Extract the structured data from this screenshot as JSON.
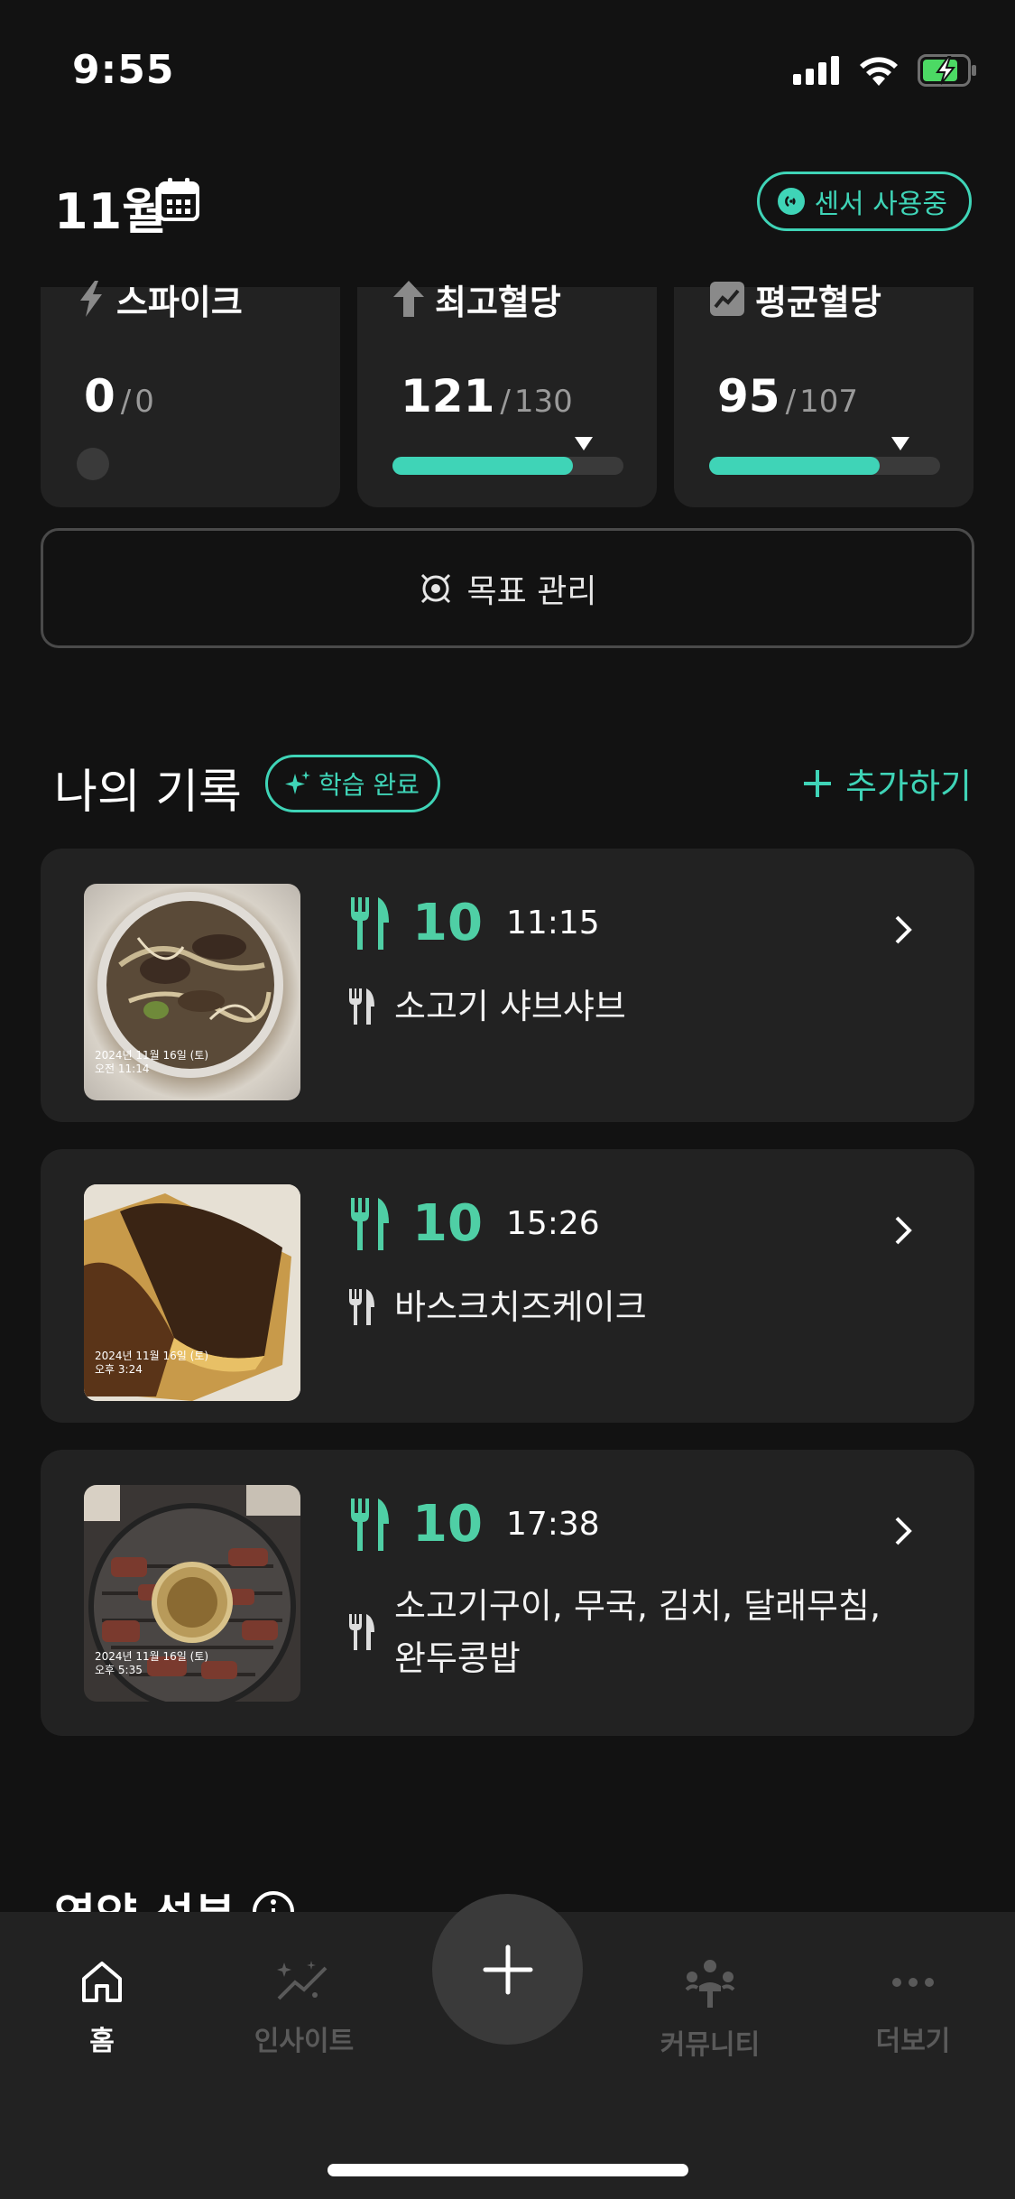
{
  "status_bar": {
    "time": "9:55"
  },
  "header": {
    "month": "11월",
    "sensor_badge": "센서 사용중"
  },
  "stats": [
    {
      "title": "스파이크",
      "value": "0",
      "target": "0",
      "icon": "bolt-icon"
    },
    {
      "title": "최고혈당",
      "value": "121",
      "target": "130",
      "icon": "arrow-up-icon",
      "progress_percent": 78
    },
    {
      "title": "평균혈당",
      "value": "95",
      "target": "107",
      "icon": "trend-chart-icon",
      "progress_percent": 74
    }
  ],
  "goal_button": {
    "label": "목표 관리"
  },
  "records": {
    "title": "나의 기록",
    "learn_badge": "학습 완료",
    "add_label": "추가하기",
    "items": [
      {
        "score": "10",
        "time": "11:15",
        "name": "소고기 샤브샤브",
        "photo_stamp_date": "2024년 11월 16일 (토)",
        "photo_stamp_time": "오전 11:14"
      },
      {
        "score": "10",
        "time": "15:26",
        "name": "바스크치즈케이크",
        "photo_stamp_date": "2024년 11월 16일 (토)",
        "photo_stamp_time": "오후 3:24"
      },
      {
        "score": "10",
        "time": "17:38",
        "name_line1": "소고기구이, 무국, 김치, 달래무침,",
        "name_line2": "완두콩밥",
        "photo_stamp_date": "2024년 11월 16일 (토)",
        "photo_stamp_time": "오후 5:35"
      }
    ]
  },
  "nutrition": {
    "title": "영양 성분"
  },
  "tab_bar": {
    "home": "홈",
    "insight": "인사이트",
    "community": "커뮤니티",
    "more": "더보기"
  },
  "colors": {
    "accent": "#3fd4b7",
    "score_green": "#4fcfa5",
    "background": "#121212",
    "card": "#222222"
  }
}
